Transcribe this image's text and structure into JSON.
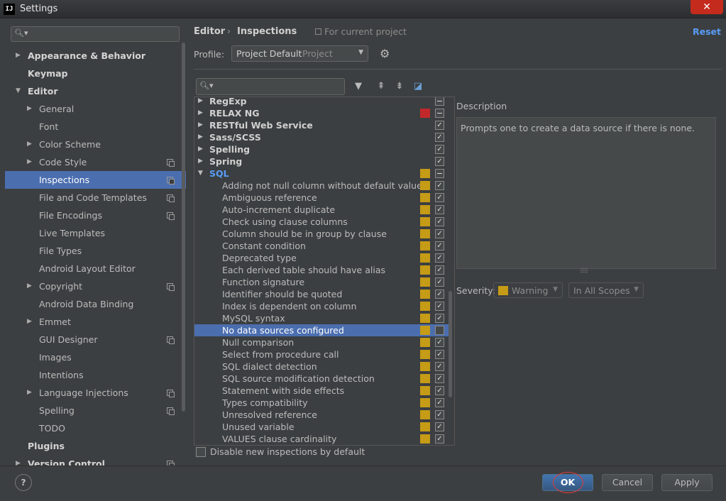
{
  "window": {
    "title": "Settings",
    "app_icon": "IJ",
    "close_glyph": "✕"
  },
  "sidebar": {
    "search_placeholder": "",
    "items": [
      {
        "label": "Appearance & Behavior",
        "level": 0,
        "arrow": "▶",
        "bold": true
      },
      {
        "label": "Keymap",
        "level": 0,
        "bold": true
      },
      {
        "label": "Editor",
        "level": 0,
        "arrow": "▼",
        "bold": true
      },
      {
        "label": "General",
        "level": 1,
        "arrow": "▶"
      },
      {
        "label": "Font",
        "level": 1
      },
      {
        "label": "Color Scheme",
        "level": 1,
        "arrow": "▶"
      },
      {
        "label": "Code Style",
        "level": 1,
        "arrow": "▶",
        "copy": true
      },
      {
        "label": "Inspections",
        "level": 1,
        "copy": true,
        "selected": true
      },
      {
        "label": "File and Code Templates",
        "level": 1,
        "copy": true
      },
      {
        "label": "File Encodings",
        "level": 1,
        "copy": true
      },
      {
        "label": "Live Templates",
        "level": 1
      },
      {
        "label": "File Types",
        "level": 1
      },
      {
        "label": "Android Layout Editor",
        "level": 1
      },
      {
        "label": "Copyright",
        "level": 1,
        "arrow": "▶",
        "copy": true
      },
      {
        "label": "Android Data Binding",
        "level": 1
      },
      {
        "label": "Emmet",
        "level": 1,
        "arrow": "▶"
      },
      {
        "label": "GUI Designer",
        "level": 1,
        "copy": true
      },
      {
        "label": "Images",
        "level": 1
      },
      {
        "label": "Intentions",
        "level": 1
      },
      {
        "label": "Language Injections",
        "level": 1,
        "arrow": "▶",
        "copy": true
      },
      {
        "label": "Spelling",
        "level": 1,
        "copy": true
      },
      {
        "label": "TODO",
        "level": 1
      },
      {
        "label": "Plugins",
        "level": 0,
        "bold": true
      },
      {
        "label": "Version Control",
        "level": 0,
        "arrow": "▶",
        "bold": true,
        "copy": true
      }
    ]
  },
  "header": {
    "crumb_editor": "Editor",
    "crumb_sep": "›",
    "crumb_inspections": "Inspections",
    "for_project": "For current project",
    "reset": "Reset"
  },
  "profile": {
    "label": "Profile:",
    "value": "Project Default",
    "scope": "Project",
    "arrow": "▼",
    "gear_glyph": "⚙"
  },
  "toolbar": {
    "filter_glyph": "▼",
    "expand_glyph": "⇞",
    "collapse_glyph": "⇟",
    "reset_glyph": "◪"
  },
  "inspections": {
    "colors": {
      "warning": "#c69b16",
      "error": "#c2282b"
    },
    "rows": [
      {
        "label": "RegExp",
        "group": true,
        "arrow": "▶",
        "check": "partial"
      },
      {
        "label": "RELAX NG",
        "group": true,
        "arrow": "▶",
        "sev": "error",
        "check": "partial"
      },
      {
        "label": "RESTful Web Service",
        "group": true,
        "arrow": "▶",
        "check": "checked"
      },
      {
        "label": "Sass/SCSS",
        "group": true,
        "arrow": "▶",
        "check": "checked"
      },
      {
        "label": "Spelling",
        "group": true,
        "arrow": "▶",
        "check": "checked"
      },
      {
        "label": "Spring",
        "group": true,
        "arrow": "▶",
        "check": "checked"
      },
      {
        "label": "SQL",
        "group": true,
        "sql": true,
        "arrow": "▼",
        "sev": "warning",
        "check": "partial"
      },
      {
        "label": "Adding not null column without default value",
        "sev": "warning",
        "check": "checked"
      },
      {
        "label": "Ambiguous reference",
        "sev": "warning",
        "check": "checked"
      },
      {
        "label": "Auto-increment duplicate",
        "sev": "warning",
        "check": "checked"
      },
      {
        "label": "Check using clause columns",
        "sev": "warning",
        "check": "checked"
      },
      {
        "label": "Column should be in group by clause",
        "sev": "warning",
        "check": "checked"
      },
      {
        "label": "Constant condition",
        "sev": "warning",
        "check": "checked"
      },
      {
        "label": "Deprecated type",
        "sev": "warning",
        "check": "checked"
      },
      {
        "label": "Each derived table should have alias",
        "sev": "warning",
        "check": "checked"
      },
      {
        "label": "Function signature",
        "sev": "warning",
        "check": "checked"
      },
      {
        "label": "Identifier should be quoted",
        "sev": "warning",
        "check": "checked"
      },
      {
        "label": "Index is dependent on column",
        "sev": "warning",
        "check": "checked"
      },
      {
        "label": "MySQL syntax",
        "sev": "warning",
        "check": "checked"
      },
      {
        "label": "No data sources configured",
        "sev": "warning",
        "check": "unchecked",
        "selected": true
      },
      {
        "label": "Null comparison",
        "sev": "warning",
        "check": "checked"
      },
      {
        "label": "Select from procedure call",
        "sev": "warning",
        "check": "checked"
      },
      {
        "label": "SQL dialect detection",
        "sev": "warning",
        "check": "checked"
      },
      {
        "label": "SQL source modification detection",
        "sev": "warning",
        "check": "checked"
      },
      {
        "label": "Statement with side effects",
        "sev": "warning",
        "check": "checked"
      },
      {
        "label": "Types compatibility",
        "sev": "warning",
        "check": "checked"
      },
      {
        "label": "Unresolved reference",
        "sev": "warning",
        "check": "checked"
      },
      {
        "label": "Unused variable",
        "sev": "warning",
        "check": "checked"
      },
      {
        "label": "VALUES clause cardinality",
        "sev": "warning",
        "check": "checked"
      }
    ]
  },
  "description": {
    "label": "Description",
    "text": "Prompts one to create a data source if there is none.",
    "grip": "⠿⠿"
  },
  "severity": {
    "label": "Severity:",
    "value": "Warning",
    "scope": "In All Scopes",
    "arrow": "▼"
  },
  "disable_new": {
    "label": "Disable new inspections by default",
    "checked": false
  },
  "buttons": {
    "help": "?",
    "ok": "OK",
    "cancel": "Cancel",
    "apply": "Apply"
  }
}
